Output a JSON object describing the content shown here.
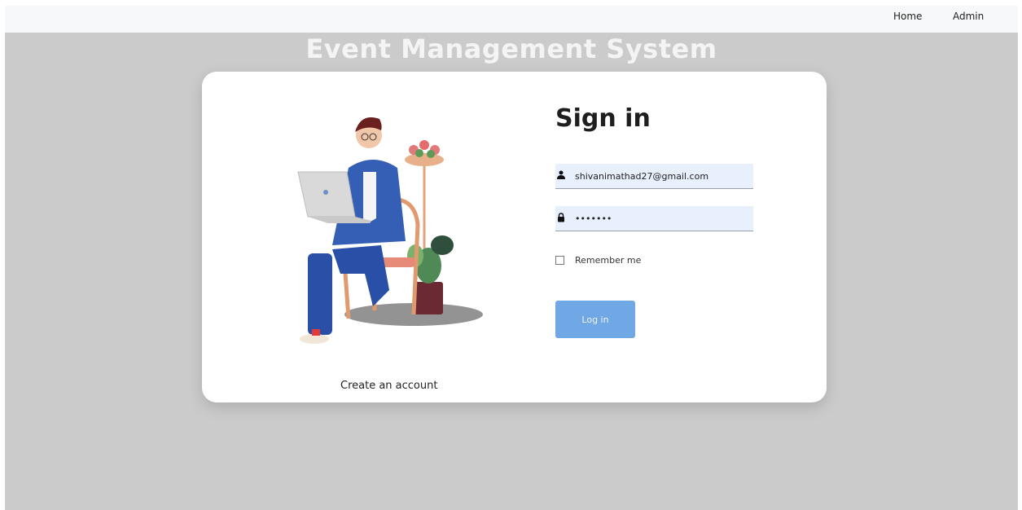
{
  "nav": {
    "home": "Home",
    "admin": "Admin"
  },
  "page_title": "Event Management System",
  "signin": {
    "title": "Sign in",
    "email_value": "shivanimathad27@gmail.com",
    "password_value": "•••••••",
    "remember_label": "Remember me",
    "remember_checked": false,
    "login_label": "Log in"
  },
  "create_account": "Create an account",
  "icons": {
    "email": "user-icon",
    "password": "lock-icon"
  },
  "colors": {
    "background": "#cbcbcb",
    "button": "#6fa8e4",
    "input_bg": "#e8f0fe"
  }
}
